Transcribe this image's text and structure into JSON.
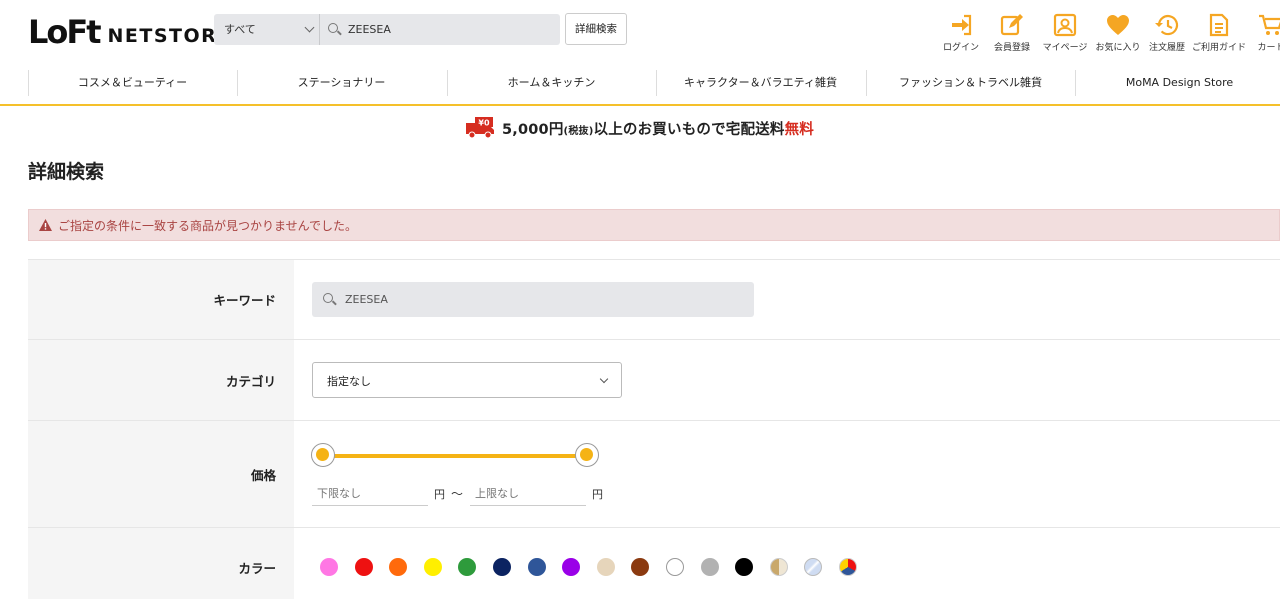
{
  "header": {
    "logo_mark": "LoFt",
    "logo_text": "NETSTORE",
    "search_category": "すべて",
    "search_value": "ZEESEA",
    "advanced_search_label": "詳細検索",
    "icons": [
      {
        "icon": "login-icon",
        "label": "ログイン"
      },
      {
        "icon": "register-icon",
        "label": "会員登録"
      },
      {
        "icon": "mypage-icon",
        "label": "マイページ"
      },
      {
        "icon": "heart-icon",
        "label": "お気に入り"
      },
      {
        "icon": "history-icon",
        "label": "注文履歴"
      },
      {
        "icon": "guide-icon",
        "label": "ご利用ガイド"
      },
      {
        "icon": "cart-icon",
        "label": "カート"
      }
    ],
    "accent_color": "#f5a623"
  },
  "nav": {
    "items": [
      "コスメ＆ビューティー",
      "ステーショナリー",
      "ホーム＆キッチン",
      "キャラクター＆バラエティ雑貨",
      "ファッション＆トラベル雑貨",
      "MoMA Design Store"
    ]
  },
  "banner": {
    "truck_label": "¥0",
    "amount": "5,000円",
    "tax": "(税抜)",
    "middle": "以上のお買いもので宅配送料",
    "free": "無料"
  },
  "page": {
    "title": "詳細検索"
  },
  "alert": {
    "message": "ご指定の条件に一致する商品が見つかりませんでした。"
  },
  "form": {
    "keyword_label": "キーワード",
    "keyword_value": "ZEESEA",
    "category_label": "カテゴリ",
    "category_value": "指定なし",
    "price_label": "価格",
    "price_min_placeholder": "下限なし",
    "price_max_placeholder": "上限なし",
    "yen": "円",
    "tilde": "〜",
    "color_label": "カラー",
    "colors": [
      {
        "name": "pink",
        "value": "#ff77e4"
      },
      {
        "name": "red",
        "value": "#ee1111"
      },
      {
        "name": "orange",
        "value": "#ff6a0c"
      },
      {
        "name": "yellow",
        "value": "#ffef00"
      },
      {
        "name": "green",
        "value": "#2e9b3c"
      },
      {
        "name": "navy",
        "value": "#0b2361"
      },
      {
        "name": "blue",
        "value": "#2f5699"
      },
      {
        "name": "purple",
        "value": "#9a00e8"
      },
      {
        "name": "beige",
        "value": "#e6d5bb"
      },
      {
        "name": "brown",
        "value": "#8b3a10"
      },
      {
        "name": "white",
        "value": "#ffffff"
      },
      {
        "name": "gray",
        "value": "#b2b2b2"
      },
      {
        "name": "black",
        "value": "#000000"
      },
      {
        "name": "gold",
        "value": "#c9a86b"
      },
      {
        "name": "silver",
        "value": "#cfdcf2"
      },
      {
        "name": "multi",
        "value": "multi"
      }
    ]
  }
}
